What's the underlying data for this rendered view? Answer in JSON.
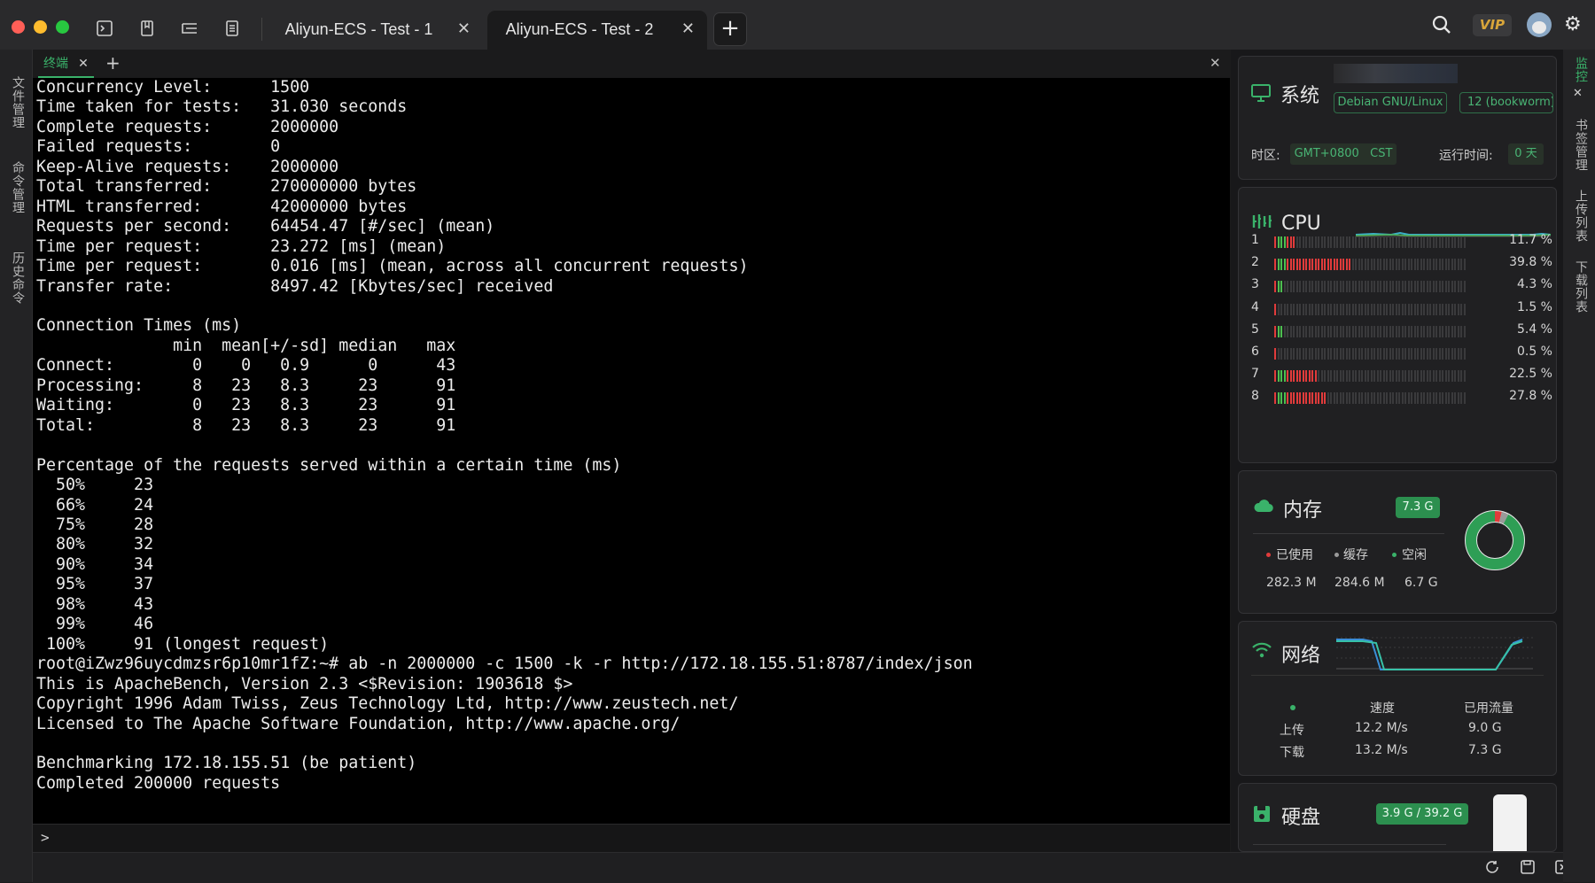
{
  "window": {
    "tabs": [
      {
        "label": "Aliyun-ECS - Test - 1"
      },
      {
        "label": "Aliyun-ECS - Test - 2"
      }
    ],
    "vip_label": "VIP"
  },
  "left_sidebar": {
    "items": [
      "文件管理",
      "命令管理",
      "历史命令"
    ]
  },
  "right_sidebar": {
    "items": [
      "监控",
      "书签管理",
      "上传列表",
      "下载列表"
    ]
  },
  "terminal": {
    "tab_label": "终端",
    "lines": [
      "Concurrency Level:      1500",
      "Time taken for tests:   31.030 seconds",
      "Complete requests:      2000000",
      "Failed requests:        0",
      "Keep-Alive requests:    2000000",
      "Total transferred:      270000000 bytes",
      "HTML transferred:       42000000 bytes",
      "Requests per second:    64454.47 [#/sec] (mean)",
      "Time per request:       23.272 [ms] (mean)",
      "Time per request:       0.016 [ms] (mean, across all concurrent requests)",
      "Transfer rate:          8497.42 [Kbytes/sec] received",
      "",
      "Connection Times (ms)",
      "              min  mean[+/-sd] median   max",
      "Connect:        0    0   0.9      0      43",
      "Processing:     8   23   8.3     23      91",
      "Waiting:        0   23   8.3     23      91",
      "Total:          8   23   8.3     23      91",
      "",
      "Percentage of the requests served within a certain time (ms)",
      "  50%     23",
      "  66%     24",
      "  75%     28",
      "  80%     32",
      "  90%     34",
      "  95%     37",
      "  98%     43",
      "  99%     46",
      " 100%     91 (longest request)",
      "root@iZwz96uycdmzsr6p10mr1fZ:~# ab -n 2000000 -c 1500 -k -r http://172.18.155.51:8787/index/json",
      "This is ApacheBench, Version 2.3 <$Revision: 1903618 $>",
      "Copyright 1996 Adam Twiss, Zeus Technology Ltd, http://www.zeustech.net/",
      "Licensed to The Apache Software Foundation, http://www.apache.org/",
      "",
      "Benchmarking 172.18.155.51 (be patient)",
      "Completed 200000 requests"
    ],
    "prompt_symbol": ">"
  },
  "system": {
    "title": "系统",
    "os": "Debian GNU/Linux",
    "version": "12 (bookworm)",
    "timezone_label": "时区:",
    "timezone": "GMT+0800   CST",
    "uptime_label": "运行时间:",
    "uptime": "0 天"
  },
  "cpu": {
    "title": "CPU",
    "cores": [
      {
        "id": "1",
        "usage": 11.7,
        "label": "11.7 %"
      },
      {
        "id": "2",
        "usage": 39.8,
        "label": "39.8 %"
      },
      {
        "id": "3",
        "usage": 4.3,
        "label": "4.3 %"
      },
      {
        "id": "4",
        "usage": 1.5,
        "label": "1.5 %"
      },
      {
        "id": "5",
        "usage": 5.4,
        "label": "5.4 %"
      },
      {
        "id": "6",
        "usage": 0.5,
        "label": "0.5 %"
      },
      {
        "id": "7",
        "usage": 22.5,
        "label": "22.5 %"
      },
      {
        "id": "8",
        "usage": 27.8,
        "label": "27.8 %"
      }
    ]
  },
  "memory": {
    "title": "内存",
    "total": "7.3 G",
    "used_label": "已使用",
    "used": "282.3 M",
    "cache_label": "缓存",
    "cache": "284.6 M",
    "free_label": "空闲",
    "free": "6.7 G",
    "used_fraction": 0.038,
    "cache_fraction": 0.038
  },
  "network": {
    "title": "网络",
    "speed_label": "速度",
    "traffic_label": "已用流量",
    "upload_label": "上传",
    "upload_speed": "12.2 M/s",
    "upload_total": "9.0 G",
    "download_label": "下载",
    "download_speed": "13.2 M/s",
    "download_total": "7.3 G"
  },
  "disk": {
    "title": "硬盘",
    "usage": "3.9 G / 39.2 G",
    "used_fraction": 0.1
  },
  "colors": {
    "accent_green": "#3ab26a",
    "bar_red": "#e13b3b",
    "bar_green": "#4cc04f",
    "bar_empty": "#3a3a3c"
  }
}
